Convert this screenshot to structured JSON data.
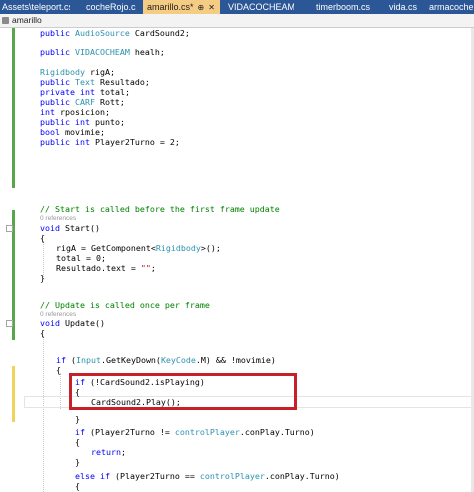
{
  "tabs": [
    {
      "label": "Assets\\teleport.cs",
      "active": false
    },
    {
      "label": "cocheRojo.cs",
      "active": false
    },
    {
      "label": "amarillo.cs*",
      "active": true
    },
    {
      "label": "VIDACOCHEAM.cs",
      "active": false
    },
    {
      "label": "timerboom.cs",
      "active": false
    },
    {
      "label": "vida.cs",
      "active": false
    },
    {
      "label": "armacoche",
      "active": false
    }
  ],
  "tab_active_pin": "⊕",
  "tab_active_close": "✕",
  "nav": {
    "label": "amarillo"
  },
  "code": {
    "l01": {
      "a": "public ",
      "b": "AudioSource",
      "c": " CardSound2;"
    },
    "l02": {
      "a": "public ",
      "b": "VIDACOCHEAM",
      "c": " healh;"
    },
    "l03": {
      "a": "Rigidbody",
      "b": " rigA;"
    },
    "l04": {
      "a": "public ",
      "b": "Text",
      "c": " Resultado;"
    },
    "l05": {
      "a": "private ",
      "b": "int",
      "c": " total;"
    },
    "l06": {
      "a": "public ",
      "b": "CARF",
      "c": " Rott;"
    },
    "l07": {
      "a": "int",
      "b": " rposicion;"
    },
    "l08": {
      "a": "public ",
      "b": "int",
      "c": " punto;"
    },
    "l09": {
      "a": "bool",
      "b": " movimie;"
    },
    "l10": {
      "a": "public ",
      "b": "int",
      "c": " Player2Turno = 2;"
    },
    "c_start": "// Start is called before the first frame update",
    "refs_start": "0 references",
    "l11": {
      "a": "void",
      "b": " Start()"
    },
    "l12": "{",
    "l13": {
      "a": "rigA = GetComponent<",
      "b": "Rigidbody",
      "c": ">();"
    },
    "l14": "total = 0;",
    "l15": {
      "a": "Resultado.text = ",
      "b": "\"\"",
      "c": ";"
    },
    "l16": "}",
    "c_update": "// Update is called once per frame",
    "refs_update": "0 references",
    "l17": {
      "a": "void",
      "b": " Update()"
    },
    "l18": "{",
    "l19": {
      "a": "if",
      "b": " (",
      "c": "Input",
      "d": ".GetKeyDown(",
      "e": "KeyCode",
      "f": ".M) && !movimie)"
    },
    "l20": "{",
    "l21": {
      "a": "if",
      "b": " (!CardSound2.isPlaying)"
    },
    "l22": "{",
    "l23": "CardSound2.Play();",
    "l24": "}",
    "l25": {
      "a": "if",
      "b": " (Player2Turno != ",
      "c": "controlPlayer",
      "d": ".conPlay.Turno)"
    },
    "l26": "{",
    "l27": {
      "a": "return",
      "b": ";"
    },
    "l28": "}",
    "l29": {
      "a": "else if",
      "b": " (Player2Turno == ",
      "c": "controlPlayer",
      "d": ".conPlay.Turno)"
    },
    "l30": "{"
  },
  "colors": {
    "keyword": "#0000ff",
    "type": "#2b91af",
    "comment": "#008000",
    "string": "#a31515",
    "highlight": "#c8202a",
    "tab_bar": "#2b5797",
    "active_tab": "#f5cc84"
  }
}
